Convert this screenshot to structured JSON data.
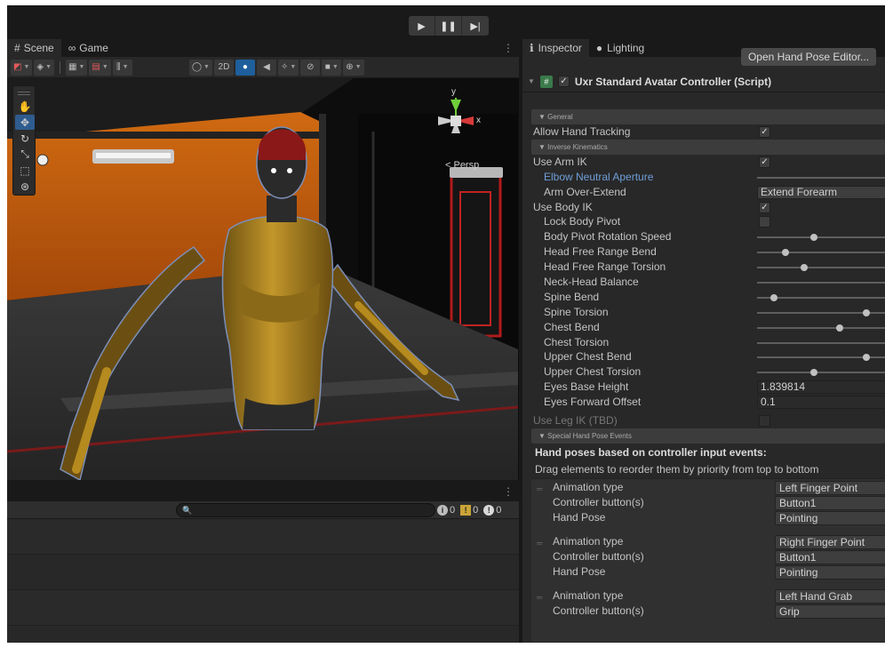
{
  "playbar": {
    "play": "▶",
    "pause": "❚❚",
    "step": "▶|"
  },
  "scene_pane": {
    "tabs": [
      {
        "icon": "#",
        "label": "Scene"
      },
      {
        "icon": "∞",
        "label": "Game"
      }
    ],
    "menu": "⋮",
    "toolbar": {
      "two_d": "2D"
    },
    "persp_label": "< Persp"
  },
  "gizmo": {
    "y": "y",
    "x": "x"
  },
  "console": {
    "menu": "⋮",
    "search_placeholder": "🔍",
    "log_count": "0",
    "warn_count": "0",
    "error_count": "0"
  },
  "inspector": {
    "tabs": [
      {
        "icon": "ℹ",
        "label": "Inspector"
      },
      {
        "icon": "●",
        "label": "Lighting"
      }
    ],
    "open_button": "Open Hand Pose Editor...",
    "component": {
      "title": "Uxr Standard Avatar Controller (Script)",
      "checked": "✓"
    },
    "sections": {
      "general": "General",
      "ik": "Inverse Kinematics",
      "events": "Special Hand Pose Events"
    },
    "props": {
      "allow_hand_tracking": "Allow Hand Tracking",
      "use_arm_ik": "Use Arm IK",
      "elbow_neutral_aperture": "Elbow Neutral Aperture",
      "arm_over_extend": "Arm Over-Extend",
      "arm_over_extend_value": "Extend Forearm",
      "use_body_ik": "Use Body IK",
      "lock_body_pivot": "Lock Body Pivot",
      "body_pivot_rotation_speed": "Body Pivot Rotation Speed",
      "head_free_range_bend": "Head Free Range Bend",
      "head_free_range_torsion": "Head Free Range Torsion",
      "neck_head_balance": "Neck-Head Balance",
      "spine_bend": "Spine Bend",
      "spine_torsion": "Spine Torsion",
      "chest_bend": "Chest Bend",
      "chest_torsion": "Chest Torsion",
      "upper_chest_bend": "Upper Chest Bend",
      "upper_chest_torsion": "Upper Chest Torsion",
      "eyes_base_height": "Eyes Base Height",
      "eyes_base_height_value": "1.839814",
      "eyes_forward_offset": "Eyes Forward Offset",
      "eyes_forward_offset_value": "0.1",
      "use_leg_ik": "Use Leg IK (TBD)"
    },
    "checkmark": "✓",
    "slider_levels": {
      "body_pivot_rotation_speed": 0.4,
      "head_free_range_bend": 0.2,
      "head_free_range_torsion": 0.33,
      "spine_bend": 0.12,
      "spine_torsion": 0.77,
      "chest_bend": 0.58,
      "upper_chest_bend": 0.77,
      "upper_chest_torsion": 0.4
    },
    "events_title": "Hand poses based on controller input events:",
    "events_desc": "Drag elements to reorder them by priority from top to bottom",
    "event_labels": {
      "animation_type": "Animation type",
      "controller_buttons": "Controller button(s)",
      "hand_pose": "Hand Pose"
    },
    "events": [
      {
        "animation_type": "Left Finger Point",
        "buttons": "Button1",
        "hand_pose": "Pointing"
      },
      {
        "animation_type": "Right Finger Point",
        "buttons": "Button1",
        "hand_pose": "Pointing"
      },
      {
        "animation_type": "Left Hand Grab",
        "buttons": "Grip"
      }
    ]
  },
  "colors": {
    "accent": "#2f5c8f",
    "editor_bg": "#282828",
    "wall_orange": "#c8620e",
    "robot_yellow": "#b58a1e",
    "link_blue": "#6f9fd8"
  }
}
